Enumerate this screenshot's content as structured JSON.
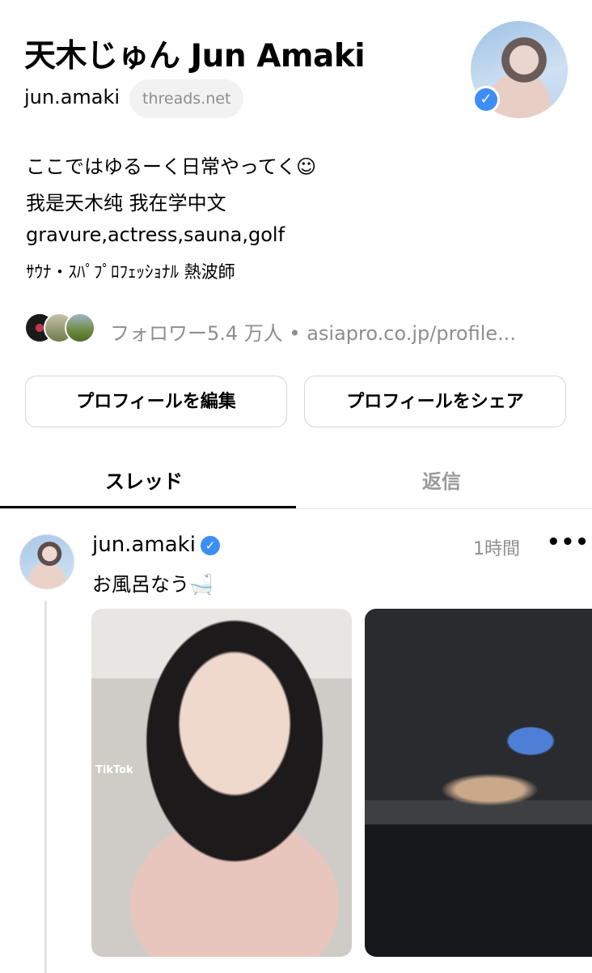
{
  "profile": {
    "name": "天木じゅん Jun Amaki",
    "handle": "jun.amaki",
    "domain": "threads.net",
    "bio": [
      "ここではゆるーく日常やってく☺︎",
      "我是天木纯 我在学中文",
      "gravure,actress,sauna,golf",
      "ｻｳﾅ・ｽﾊﾟﾌﾟﾛﾌｪｯｼｮﾅﾙ 熱波師"
    ],
    "followers_text": "フォロワー5.4 万人 • asiapro.co.jp/profile..."
  },
  "buttons": {
    "edit": "プロフィールを編集",
    "share": "プロフィールをシェア"
  },
  "tabs": {
    "threads": "スレッド",
    "replies": "返信"
  },
  "post": {
    "user": "jun.amaki",
    "time": "1時間",
    "more": "•••",
    "text": "お風呂なう🛁",
    "media_overlay": "TikTok"
  },
  "icons": {
    "verified": "✓"
  },
  "colors": {
    "verified": "#3e8ef7",
    "muted": "#8e8e8e"
  }
}
